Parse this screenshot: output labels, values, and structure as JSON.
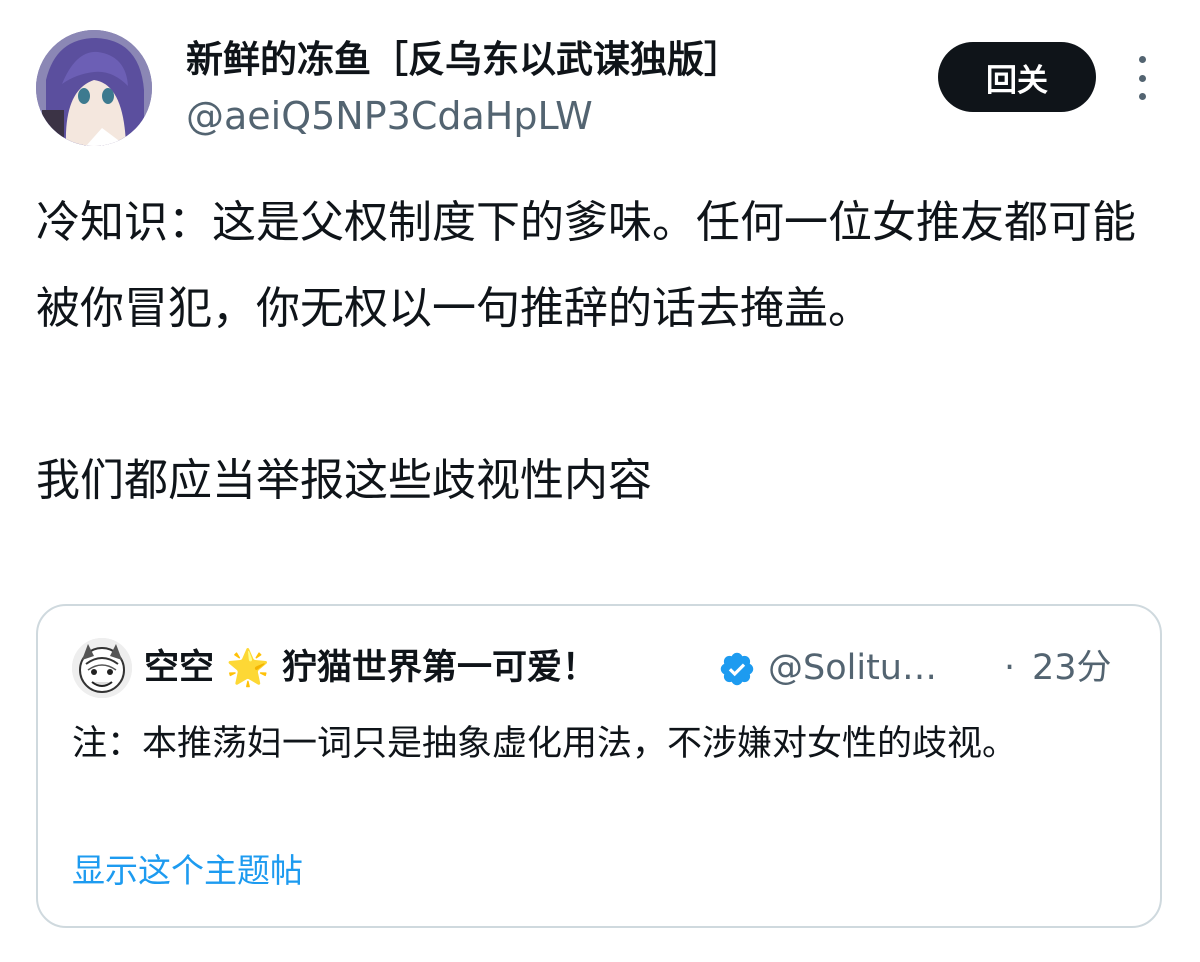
{
  "author": {
    "display_name": "新鲜的冻鱼［反乌东以武谋独版］",
    "handle": "@aeiQ5NP3CdaHpLW"
  },
  "actions": {
    "follow_label": "回关",
    "more_icon": "more-vertical-icon"
  },
  "tweet": {
    "text": "冷知识：这是父权制度下的爹味。任何一位女推友都可能被你冒犯，你无权以一句推辞的话去掩盖。\n\n我们都应当举报这些歧视性内容"
  },
  "quote": {
    "display_name": "空空",
    "sparkle": "🌟",
    "display_name_suffix": "狞猫世界第一可爱！",
    "verified_icon": "verified-badge-icon",
    "handle": "@Solitu…",
    "separator": "·",
    "time": "23分",
    "text": "注：本推荡妇一词只是抽象虚化用法，不涉嫌对女性的歧视。",
    "show_thread_label": "显示这个主题帖"
  },
  "colors": {
    "text_primary": "#0f1419",
    "text_secondary": "#536471",
    "link": "#1d9bf0",
    "button_bg": "#0f1419",
    "border": "#cfd9de",
    "verified": "#1d9bf0"
  }
}
